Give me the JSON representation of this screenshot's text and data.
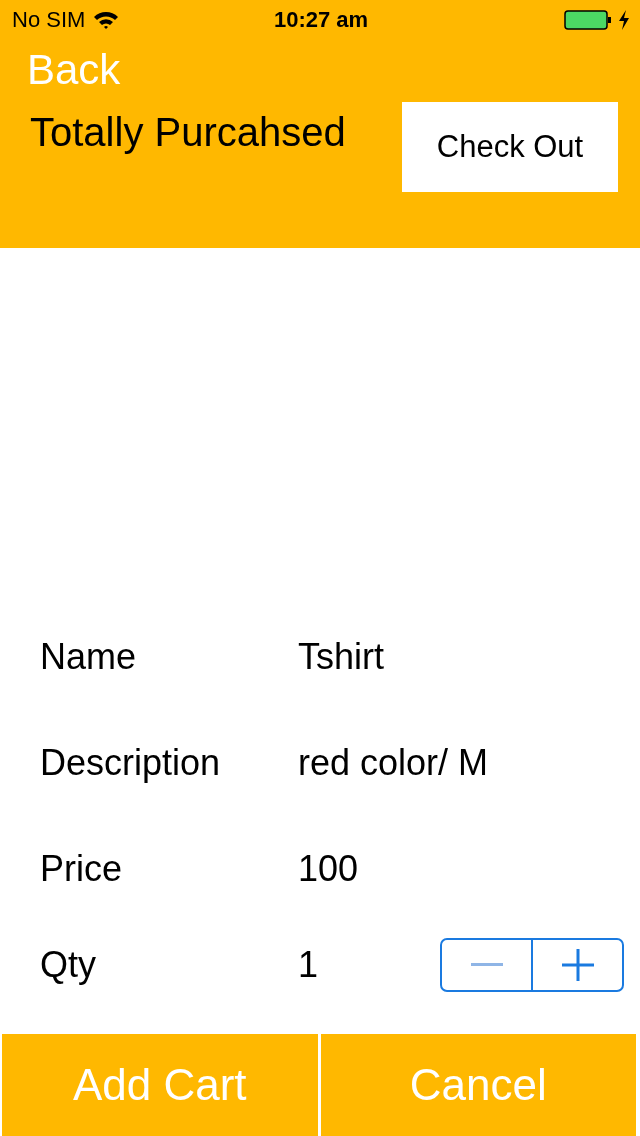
{
  "status_bar": {
    "carrier": "No SIM",
    "time": "10:27 am"
  },
  "nav": {
    "back": "Back",
    "title": "Totally Purcahsed",
    "checkout_button": "Check Out"
  },
  "details": [
    {
      "kind": "text",
      "label": "Name",
      "value": "Tshirt"
    },
    {
      "kind": "text",
      "label": "Description",
      "value": "red color/ M"
    },
    {
      "kind": "text",
      "label": "Price",
      "value": "100"
    },
    {
      "kind": "stepper",
      "label": "Qty",
      "value": "1",
      "stepper": {
        "decrement_disabled": true,
        "increment_disabled": false
      }
    }
  ],
  "buttons": [
    "Add Cart",
    "Cancel"
  ]
}
